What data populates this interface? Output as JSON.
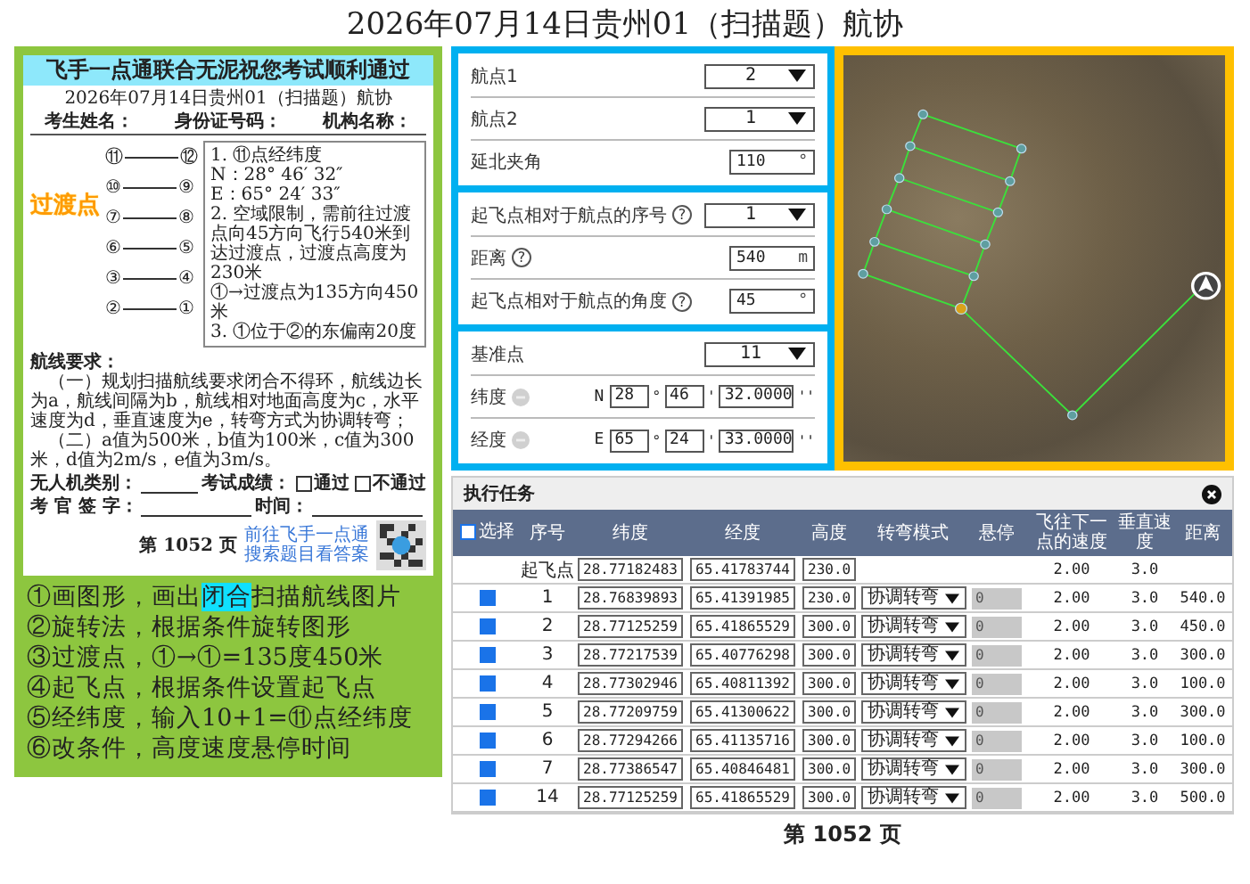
{
  "page_title": "2026年07月14日贵州01（扫描题）航协",
  "exam_sheet": {
    "banner": "飞手一点通联合无泥祝您考试顺利通过",
    "title": "2026年07月14日贵州01（扫描题）航协",
    "info_fields": [
      "考生姓名：",
      "身份证号码：",
      "机构名称："
    ],
    "callout": "过渡点",
    "waypoint_pairs": [
      {
        "left": "⑪",
        "right": "⑫"
      },
      {
        "left": "⑩",
        "right": "⑨"
      },
      {
        "left": "⑦",
        "right": "⑧"
      },
      {
        "left": "⑥",
        "right": "⑤"
      },
      {
        "left": "③",
        "right": "④"
      },
      {
        "left": "②",
        "right": "①"
      }
    ],
    "notes": [
      "1. ⑪点经纬度",
      "N：28° 46′ 32″",
      "E：65° 24′ 33″",
      "2. 空域限制，需前往过渡点向45方向飞行540米到达过渡点，过渡点高度为230米",
      "①→过渡点为135方向450米",
      "3. ①位于②的东偏南20度"
    ],
    "requirements_title": "航线要求：",
    "requirements": [
      "（一）规划扫描航线要求闭合不得环，航线边长为a，航线间隔为b，航线相对地面高度为c，水平速度为d，垂直速度为e，转弯方式为协调转弯；",
      "（二）a值为500米，b值为100米，c值为300米，d值为2m/s，e值为3m/s。"
    ],
    "category_label": "无人机类别：",
    "result_label": "考试成绩：",
    "result_options": [
      {
        "label": "通过",
        "checked": false
      },
      {
        "label": "不通过",
        "checked": false
      }
    ],
    "signer_label": "考 官 签 字：",
    "time_label": "时间：",
    "promo": [
      "前往飞手一点通",
      "搜索题目看答案"
    ],
    "page_number": "第 1052 页"
  },
  "steps": [
    {
      "parts": [
        {
          "text": "①画图形，画出",
          "highlighted": false
        },
        {
          "text": "闭合",
          "highlighted": true
        },
        {
          "text": "扫描航线图片",
          "highlighted": false
        }
      ]
    },
    {
      "parts": [
        {
          "text": "②旋转法，根据条件旋转图形",
          "highlighted": false
        }
      ]
    },
    {
      "parts": [
        {
          "text": "③过渡点，①→①=135度450米",
          "highlighted": false
        }
      ]
    },
    {
      "parts": [
        {
          "text": "④起飞点，根据条件设置起飞点",
          "highlighted": false
        }
      ]
    },
    {
      "parts": [
        {
          "text": "⑤经纬度，输入10+1=⑪点经纬度",
          "highlighted": false
        }
      ]
    },
    {
      "parts": [
        {
          "text": "⑥改条件，高度速度悬停时间",
          "highlighted": false
        }
      ]
    }
  ],
  "route_form": {
    "sections": [
      {
        "rows": [
          {
            "kind": "select",
            "label": "航点1",
            "value": "2"
          },
          {
            "kind": "select",
            "label": "航点2",
            "value": "1"
          },
          {
            "kind": "input",
            "label": "延北夹角",
            "value": "110",
            "unit": "°"
          }
        ]
      },
      {
        "rows": [
          {
            "kind": "select",
            "label": "起飞点相对于航点的序号",
            "help": "?",
            "value": "1"
          },
          {
            "kind": "input",
            "label": "距离",
            "help": "?",
            "value": "540",
            "unit": "m"
          },
          {
            "kind": "input",
            "label": "起飞点相对于航点的角度",
            "help": "?",
            "value": "45",
            "unit": "°"
          }
        ]
      },
      {
        "rows": [
          {
            "kind": "select",
            "label": "基准点",
            "value": "11"
          },
          {
            "kind": "coord",
            "label": "纬度",
            "hemisphere": "N",
            "parts": [
              {
                "value": "28",
                "unit": "°"
              },
              {
                "value": "46",
                "unit": "'"
              },
              {
                "value": "32.0000",
                "unit": "''"
              }
            ]
          },
          {
            "kind": "coord",
            "label": "经度",
            "hemisphere": "E",
            "parts": [
              {
                "value": "65",
                "unit": "°"
              },
              {
                "value": "24",
                "unit": "'"
              },
              {
                "value": "33.0000",
                "unit": "''"
              }
            ]
          }
        ]
      }
    ]
  },
  "task_table": {
    "title": "执行任务",
    "select_label": "选择",
    "select_all_checked": false,
    "columns": [
      "序号",
      "纬度",
      "经度",
      "高度",
      "转弯模式",
      "悬停",
      "飞往下一点的速度",
      "垂直速度",
      "距离"
    ],
    "rows": [
      {
        "kind": "takeoff",
        "index": "起飞点",
        "lat": "28.77182483",
        "lon": "65.41783744",
        "alt": "230.0",
        "speed": "2.00",
        "vspeed": "3.0"
      },
      {
        "kind": "waypoint",
        "checked": true,
        "index": "1",
        "lat": "28.76839893",
        "lon": "65.41391985",
        "alt": "230.0",
        "turn": "协调转弯",
        "hover": "0",
        "speed": "2.00",
        "vspeed": "3.0",
        "distance": "540.0"
      },
      {
        "kind": "waypoint",
        "checked": true,
        "index": "2",
        "lat": "28.77125259",
        "lon": "65.41865529",
        "alt": "300.0",
        "turn": "协调转弯",
        "hover": "0",
        "speed": "2.00",
        "vspeed": "3.0",
        "distance": "450.0"
      },
      {
        "kind": "waypoint",
        "checked": true,
        "index": "3",
        "lat": "28.77217539",
        "lon": "65.40776298",
        "alt": "300.0",
        "turn": "协调转弯",
        "hover": "0",
        "speed": "2.00",
        "vspeed": "3.0",
        "distance": "300.0"
      },
      {
        "kind": "waypoint",
        "checked": true,
        "index": "4",
        "lat": "28.77302946",
        "lon": "65.40811392",
        "alt": "300.0",
        "turn": "协调转弯",
        "hover": "0",
        "speed": "2.00",
        "vspeed": "3.0",
        "distance": "100.0"
      },
      {
        "kind": "waypoint",
        "checked": true,
        "index": "5",
        "lat": "28.77209759",
        "lon": "65.41300622",
        "alt": "300.0",
        "turn": "协调转弯",
        "hover": "0",
        "speed": "2.00",
        "vspeed": "3.0",
        "distance": "300.0"
      },
      {
        "kind": "waypoint",
        "checked": true,
        "index": "6",
        "lat": "28.77294266",
        "lon": "65.41135716",
        "alt": "300.0",
        "turn": "协调转弯",
        "hover": "0",
        "speed": "2.00",
        "vspeed": "3.0",
        "distance": "100.0"
      },
      {
        "kind": "waypoint",
        "checked": true,
        "index": "7",
        "lat": "28.77386547",
        "lon": "65.40846481",
        "alt": "300.0",
        "turn": "协调转弯",
        "hover": "0",
        "speed": "2.00",
        "vspeed": "3.0",
        "distance": "300.0"
      },
      {
        "kind": "waypoint",
        "checked": true,
        "index": "14",
        "lat": "28.77125259",
        "lon": "65.41865529",
        "alt": "300.0",
        "turn": "协调转弯",
        "hover": "0",
        "speed": "2.00",
        "vspeed": "3.0",
        "distance": "500.0"
      }
    ]
  },
  "footer_page": "第 1052 页"
}
